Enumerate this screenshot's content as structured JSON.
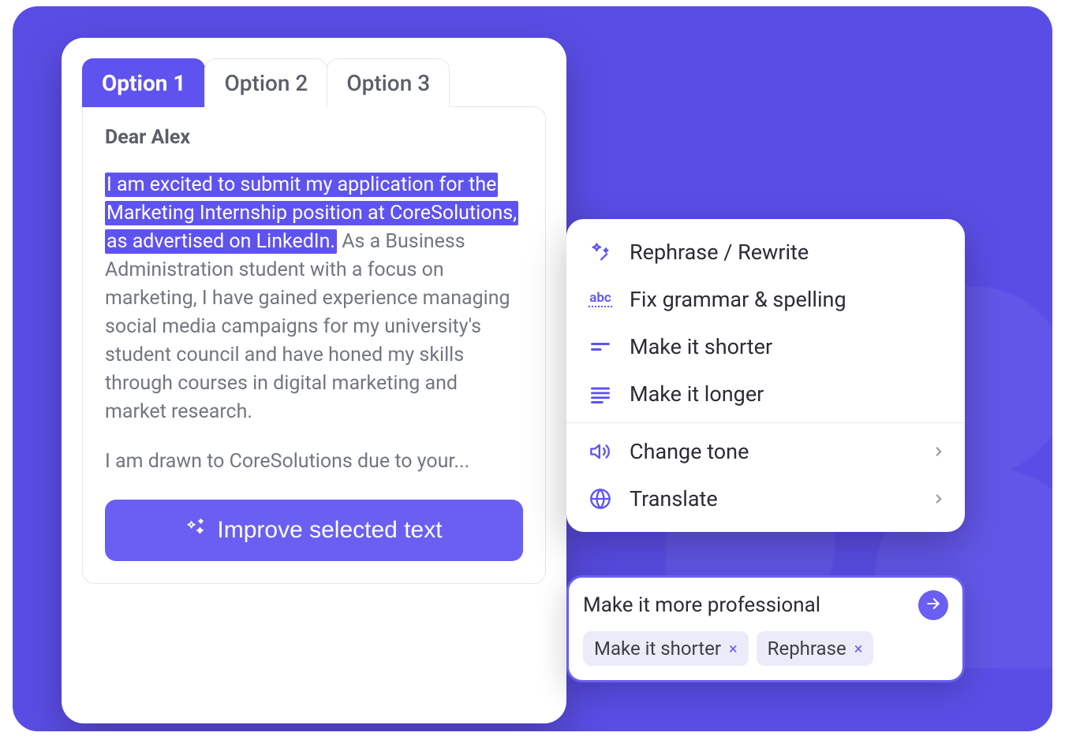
{
  "tabs": [
    {
      "label": "Option 1",
      "active": true
    },
    {
      "label": "Option 2",
      "active": false
    },
    {
      "label": "Option 3",
      "active": false
    }
  ],
  "editor": {
    "greeting": "Dear Alex",
    "highlighted": "I am excited to submit my application for the Marketing Internship position at CoreSolutions, as advertised on LinkedIn.",
    "rest": " As a Business Administration student with a focus on marketing, I have gained experience managing social media campaigns for my university's student council and have honed my skills through courses in digital marketing and market research.",
    "tail": "I am drawn to CoreSolutions due to your...",
    "improve_label": "Improve selected text"
  },
  "menu": {
    "items": [
      {
        "icon": "sparkles",
        "label": "Rephrase / Rewrite",
        "submenu": false
      },
      {
        "icon": "abc",
        "label": "Fix grammar & spelling",
        "submenu": false
      },
      {
        "icon": "shorter",
        "label": "Make it shorter",
        "submenu": false
      },
      {
        "icon": "longer",
        "label": "Make it longer",
        "submenu": false
      }
    ],
    "submenu_items": [
      {
        "icon": "tone",
        "label": "Change tone",
        "submenu": true
      },
      {
        "icon": "globe",
        "label": "Translate",
        "submenu": true
      }
    ]
  },
  "prompt": {
    "title": "Make it more professional",
    "chips": [
      {
        "label": "Make it shorter"
      },
      {
        "label": "Rephrase"
      }
    ]
  },
  "colors": {
    "accent": "#5f53f0"
  }
}
